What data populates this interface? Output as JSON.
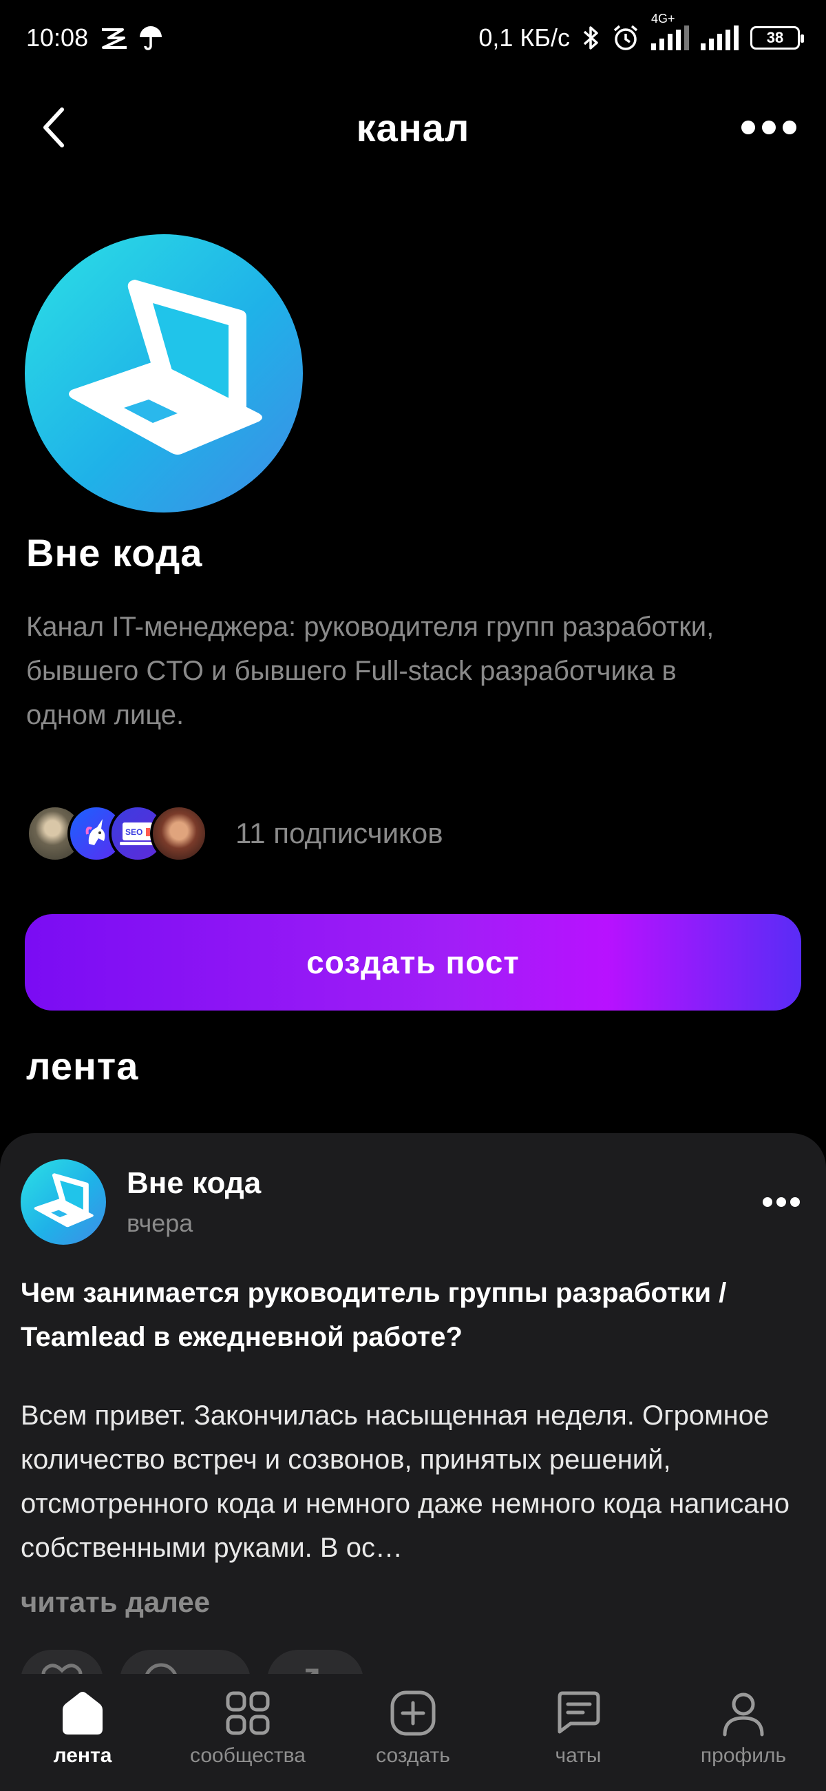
{
  "status_bar": {
    "time": "10:08",
    "network_speed": "0,1 КБ/с",
    "network_type": "4G+",
    "battery": "38",
    "icons": [
      "notification-icon",
      "umbrella-icon",
      "bluetooth-icon",
      "alarm-icon",
      "signal-icon",
      "signal-icon",
      "battery-icon"
    ]
  },
  "header": {
    "title": "канал",
    "back_icon": "chevron-left-icon",
    "more_icon": "more-horizontal-icon"
  },
  "channel": {
    "name": "Вне кода",
    "description": "Канал IT-менеджера: руководителя групп разработки, бывшего CTO и бывшего Full-stack разработчика в одном лице.",
    "avatar_icon": "laptop-icon",
    "subscribers": "11 подписчиков",
    "create_post_label": "создать пост"
  },
  "feed": {
    "section_title": "лента",
    "posts": [
      {
        "author": "Вне кода",
        "time": "вчера",
        "title": "Чем занимается руководитель группы разработки / Teamlead в ежедневной работе?",
        "body": "Всем привет. Закончилась насыщенная неделя. Огромное количество встреч и созвонов, принятых решений, отсмотренного кода и немного даже немного кода написано собственными руками. В ос…",
        "read_more": "читать далее"
      }
    ]
  },
  "bottom_nav": {
    "items": [
      {
        "label": "лента",
        "icon": "feed-icon",
        "active": true
      },
      {
        "label": "сообщества",
        "icon": "grid-icon",
        "active": false
      },
      {
        "label": "создать",
        "icon": "plus-square-icon",
        "active": false
      },
      {
        "label": "чаты",
        "icon": "chat-icon",
        "active": false
      },
      {
        "label": "профиль",
        "icon": "profile-icon",
        "active": false
      }
    ]
  },
  "colors": {
    "background": "#000000",
    "card": "#1c1c1e",
    "accent_start": "#7a0cf3",
    "accent_end": "#5a2cf6",
    "muted_text": "#8a8a8a"
  }
}
